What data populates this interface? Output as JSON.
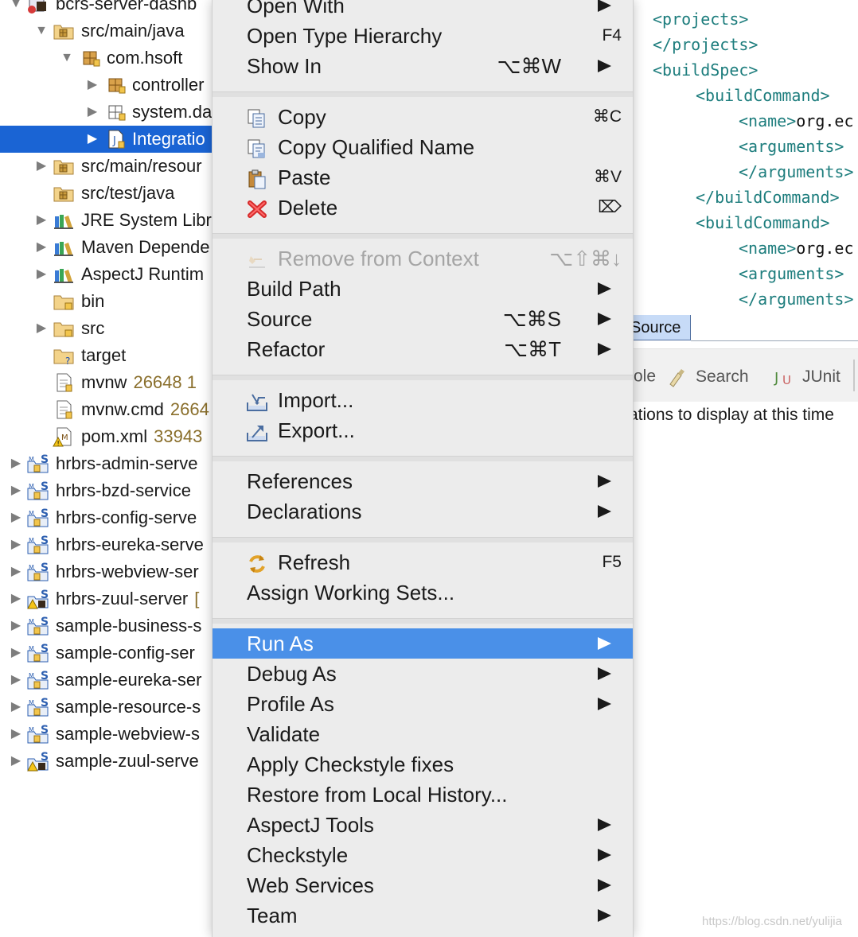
{
  "tree": {
    "rows": [
      {
        "label": "bcrs-server-dashb",
        "meta": "",
        "indent": 0,
        "twisty": "down",
        "icon": "maven-project-error-icon"
      },
      {
        "label": "src/main/java",
        "meta": "",
        "indent": 1,
        "twisty": "down",
        "icon": "source-folder-icon"
      },
      {
        "label": "com.hsoft",
        "meta": "",
        "indent": 2,
        "twisty": "down",
        "icon": "package-icon"
      },
      {
        "label": "controller",
        "meta": "",
        "indent": 3,
        "twisty": "right",
        "icon": "package-icon"
      },
      {
        "label": "system.da",
        "meta": "",
        "indent": 3,
        "twisty": "right",
        "icon": "package-empty-icon"
      },
      {
        "label": "Integratio",
        "meta": "",
        "indent": 3,
        "twisty": "right",
        "icon": "java-file-icon",
        "selected": true
      },
      {
        "label": "src/main/resour",
        "meta": "",
        "indent": 1,
        "twisty": "right",
        "icon": "source-folder-icon"
      },
      {
        "label": "src/test/java",
        "meta": "",
        "indent": 1,
        "twisty": "none",
        "icon": "source-folder-icon"
      },
      {
        "label": "JRE System Libr",
        "meta": "",
        "indent": 1,
        "twisty": "right",
        "icon": "library-icon"
      },
      {
        "label": "Maven Depende",
        "meta": "",
        "indent": 1,
        "twisty": "right",
        "icon": "library-icon"
      },
      {
        "label": "AspectJ Runtim",
        "meta": "",
        "indent": 1,
        "twisty": "right",
        "icon": "library-icon"
      },
      {
        "label": "bin",
        "meta": "",
        "indent": 1,
        "twisty": "none",
        "icon": "folder-icon"
      },
      {
        "label": "src",
        "meta": "",
        "indent": 1,
        "twisty": "right",
        "icon": "folder-icon"
      },
      {
        "label": "target",
        "meta": "",
        "indent": 1,
        "twisty": "none",
        "icon": "folder-unknown-icon"
      },
      {
        "label": "mvnw",
        "meta": "26648  1",
        "indent": 1,
        "twisty": "none",
        "icon": "text-file-icon"
      },
      {
        "label": "mvnw.cmd",
        "meta": "2664",
        "indent": 1,
        "twisty": "none",
        "icon": "text-file-icon"
      },
      {
        "label": "pom.xml",
        "meta": "33943",
        "indent": 1,
        "twisty": "none",
        "icon": "xml-file-warning-icon"
      },
      {
        "label": "hrbrs-admin-serve",
        "meta": "",
        "indent": 0,
        "twisty": "right",
        "icon": "spring-project-icon"
      },
      {
        "label": "hrbrs-bzd-service",
        "meta": "",
        "indent": 0,
        "twisty": "right",
        "icon": "spring-project-icon"
      },
      {
        "label": "hrbrs-config-serve",
        "meta": "",
        "indent": 0,
        "twisty": "right",
        "icon": "spring-project-icon"
      },
      {
        "label": "hrbrs-eureka-serve",
        "meta": "",
        "indent": 0,
        "twisty": "right",
        "icon": "spring-project-icon"
      },
      {
        "label": "hrbrs-webview-ser",
        "meta": "",
        "indent": 0,
        "twisty": "right",
        "icon": "spring-project-icon"
      },
      {
        "label": "hrbrs-zuul-server",
        "meta": "[",
        "indent": 0,
        "twisty": "right",
        "icon": "spring-project-warning-icon"
      },
      {
        "label": "sample-business-s",
        "meta": "",
        "indent": 0,
        "twisty": "right",
        "icon": "spring-project-icon"
      },
      {
        "label": "sample-config-ser",
        "meta": "",
        "indent": 0,
        "twisty": "right",
        "icon": "spring-project-icon"
      },
      {
        "label": "sample-eureka-ser",
        "meta": "",
        "indent": 0,
        "twisty": "right",
        "icon": "spring-project-icon"
      },
      {
        "label": "sample-resource-s",
        "meta": "",
        "indent": 0,
        "twisty": "right",
        "icon": "spring-project-icon"
      },
      {
        "label": "sample-webview-s",
        "meta": "",
        "indent": 0,
        "twisty": "right",
        "icon": "spring-project-icon"
      },
      {
        "label": "sample-zuul-serve",
        "meta": "",
        "indent": 0,
        "twisty": "right",
        "icon": "spring-project-warning-icon"
      }
    ]
  },
  "menu": {
    "groups": [
      [
        {
          "label": "Open With",
          "shortcut": "",
          "submenu": true,
          "icon": ""
        },
        {
          "label": "Open Type Hierarchy",
          "shortcut": "F4",
          "submenu": false,
          "icon": ""
        },
        {
          "label": "Show In",
          "shortcut": "⌥⌘W",
          "submenu": true,
          "icon": ""
        }
      ],
      [
        {
          "label": "Copy",
          "shortcut": "⌘C",
          "submenu": false,
          "icon": "copy-icon"
        },
        {
          "label": "Copy Qualified Name",
          "shortcut": "",
          "submenu": false,
          "icon": "copy-qualified-name-icon"
        },
        {
          "label": "Paste",
          "shortcut": "⌘V",
          "submenu": false,
          "icon": "paste-icon"
        },
        {
          "label": "Delete",
          "shortcut": "⌦",
          "submenu": false,
          "icon": "delete-icon"
        }
      ],
      [
        {
          "label": "Remove from Context",
          "shortcut": "⌥⇧⌘↓",
          "submenu": false,
          "icon": "remove-context-icon",
          "disabled": true
        },
        {
          "label": "Build Path",
          "shortcut": "",
          "submenu": true,
          "icon": ""
        },
        {
          "label": "Source",
          "shortcut": "⌥⌘S",
          "submenu": true,
          "icon": ""
        },
        {
          "label": "Refactor",
          "shortcut": "⌥⌘T",
          "submenu": true,
          "icon": ""
        }
      ],
      [
        {
          "label": "Import...",
          "shortcut": "",
          "submenu": false,
          "icon": "import-icon"
        },
        {
          "label": "Export...",
          "shortcut": "",
          "submenu": false,
          "icon": "export-icon"
        }
      ],
      [
        {
          "label": "References",
          "shortcut": "",
          "submenu": true,
          "icon": ""
        },
        {
          "label": "Declarations",
          "shortcut": "",
          "submenu": true,
          "icon": ""
        }
      ],
      [
        {
          "label": "Refresh",
          "shortcut": "F5",
          "submenu": false,
          "icon": "refresh-icon"
        },
        {
          "label": "Assign Working Sets...",
          "shortcut": "",
          "submenu": false,
          "icon": ""
        }
      ],
      [
        {
          "label": "Run As",
          "shortcut": "",
          "submenu": true,
          "icon": "",
          "highlighted": true
        },
        {
          "label": "Debug As",
          "shortcut": "",
          "submenu": true,
          "icon": ""
        },
        {
          "label": "Profile As",
          "shortcut": "",
          "submenu": true,
          "icon": ""
        },
        {
          "label": "Validate",
          "shortcut": "",
          "submenu": false,
          "icon": ""
        },
        {
          "label": "Apply Checkstyle fixes",
          "shortcut": "",
          "submenu": false,
          "icon": ""
        },
        {
          "label": "Restore from Local History...",
          "shortcut": "",
          "submenu": false,
          "icon": ""
        },
        {
          "label": "AspectJ Tools",
          "shortcut": "",
          "submenu": true,
          "icon": ""
        },
        {
          "label": "Checkstyle",
          "shortcut": "",
          "submenu": true,
          "icon": ""
        },
        {
          "label": "Web Services",
          "shortcut": "",
          "submenu": true,
          "icon": ""
        },
        {
          "label": "Team",
          "shortcut": "",
          "submenu": true,
          "icon": ""
        }
      ]
    ]
  },
  "editor": {
    "lines": [
      {
        "indent": 0,
        "tag": "<projects>",
        "text": ""
      },
      {
        "indent": 0,
        "tag": "</projects>",
        "text": ""
      },
      {
        "indent": 0,
        "tag": "<buildSpec>",
        "text": ""
      },
      {
        "indent": 1,
        "tag": "<buildCommand>",
        "text": ""
      },
      {
        "indent": 2,
        "tag": "<name>",
        "text": "org.ec"
      },
      {
        "indent": 2,
        "tag": "<arguments>",
        "text": ""
      },
      {
        "indent": 2,
        "tag": "</arguments>",
        "text": ""
      },
      {
        "indent": 1,
        "tag": "</buildCommand>",
        "text": ""
      },
      {
        "indent": 1,
        "tag": "<buildCommand>",
        "text": ""
      },
      {
        "indent": 2,
        "tag": "<name>",
        "text": "org.ec"
      },
      {
        "indent": 2,
        "tag": "<arguments>",
        "text": ""
      },
      {
        "indent": 2,
        "tag": "</arguments>",
        "text": ""
      }
    ],
    "source_tab": "Source",
    "bottom_tabs": [
      {
        "label": "ole",
        "icon": ""
      },
      {
        "label": "Search",
        "icon": "search-icon"
      },
      {
        "label": "JUnit",
        "icon": "junit-icon"
      }
    ],
    "status_text": "ations to display at this time"
  },
  "watermark": "https://blog.csdn.net/yulijia",
  "colors": {
    "selection": "#1a64d4",
    "menu_highlight": "#4a90e8",
    "xml_tag": "#1d7d7d",
    "menu_background": "#ececec"
  }
}
